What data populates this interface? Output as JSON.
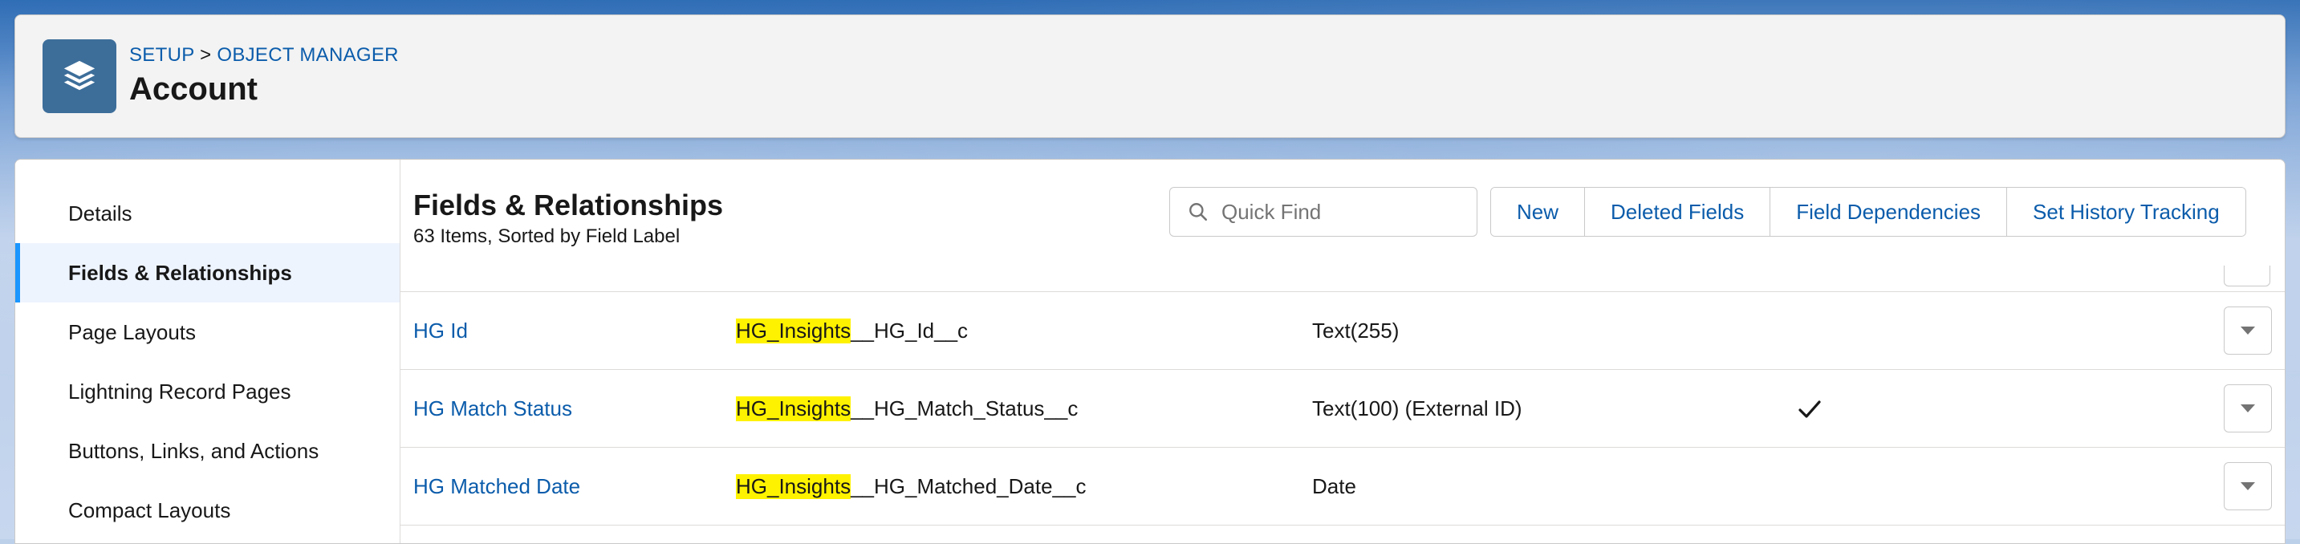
{
  "header": {
    "breadcrumb": {
      "setup": "SETUP",
      "separator": ">",
      "object_manager": "OBJECT MANAGER"
    },
    "title": "Account",
    "object_icon": "layers-icon"
  },
  "sidebar": {
    "items": [
      {
        "label": "Details",
        "active": false
      },
      {
        "label": "Fields & Relationships",
        "active": true
      },
      {
        "label": "Page Layouts",
        "active": false
      },
      {
        "label": "Lightning Record Pages",
        "active": false
      },
      {
        "label": "Buttons, Links, and Actions",
        "active": false
      },
      {
        "label": "Compact Layouts",
        "active": false
      }
    ]
  },
  "content": {
    "title": "Fields & Relationships",
    "subtitle": "63 Items, Sorted by Field Label",
    "search": {
      "placeholder": "Quick Find",
      "value": ""
    },
    "buttons": {
      "new": "New",
      "deleted_fields": "Deleted Fields",
      "field_dependencies": "Field Dependencies",
      "set_history_tracking": "Set History Tracking"
    }
  },
  "rows": [
    {
      "label": "HG Id",
      "api_highlight": "HG_Insights",
      "api_rest": "__HG_Id__c",
      "type": "Text(255)",
      "indexed": false
    },
    {
      "label": "HG Match Status",
      "api_highlight": "HG_Insights",
      "api_rest": "__HG_Match_Status__c",
      "type": "Text(100) (External ID)",
      "indexed": true
    },
    {
      "label": "HG Matched Date",
      "api_highlight": "HG_Insights",
      "api_rest": "__HG_Matched_Date__c",
      "type": "Date",
      "indexed": false
    }
  ],
  "colors": {
    "link": "#0b5cab",
    "highlight": "#fff200",
    "active_nav_bg": "#eef4fe",
    "active_nav_bar": "#1b96ff",
    "icon_bg": "#3d6e9a"
  }
}
